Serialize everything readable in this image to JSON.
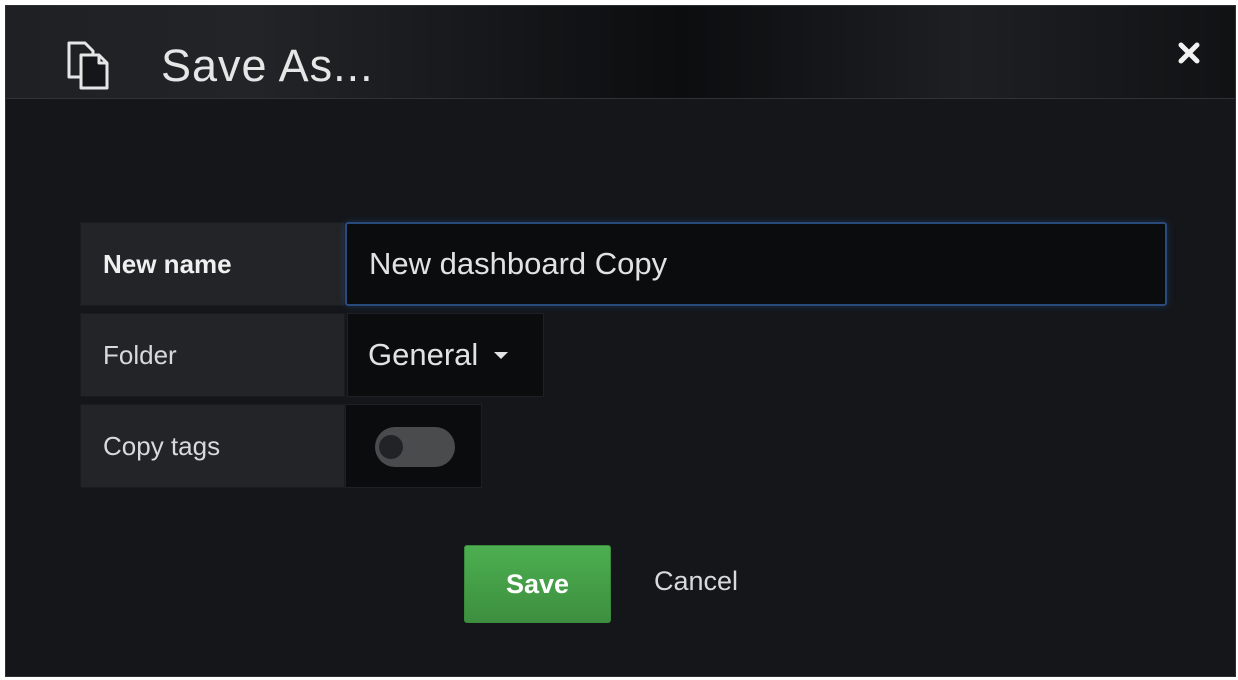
{
  "modal": {
    "title": "Save As...",
    "icon": "copy-icon",
    "close_icon": "close-icon"
  },
  "form": {
    "new_name": {
      "label": "New name",
      "value": "New dashboard Copy"
    },
    "folder": {
      "label": "Folder",
      "selected": "General"
    },
    "copy_tags": {
      "label": "Copy tags",
      "enabled": false
    }
  },
  "actions": {
    "save_label": "Save",
    "cancel_label": "Cancel"
  },
  "colors": {
    "background": "#141619",
    "accent_green": "#45a348",
    "focus_border": "#2b4a7c"
  }
}
